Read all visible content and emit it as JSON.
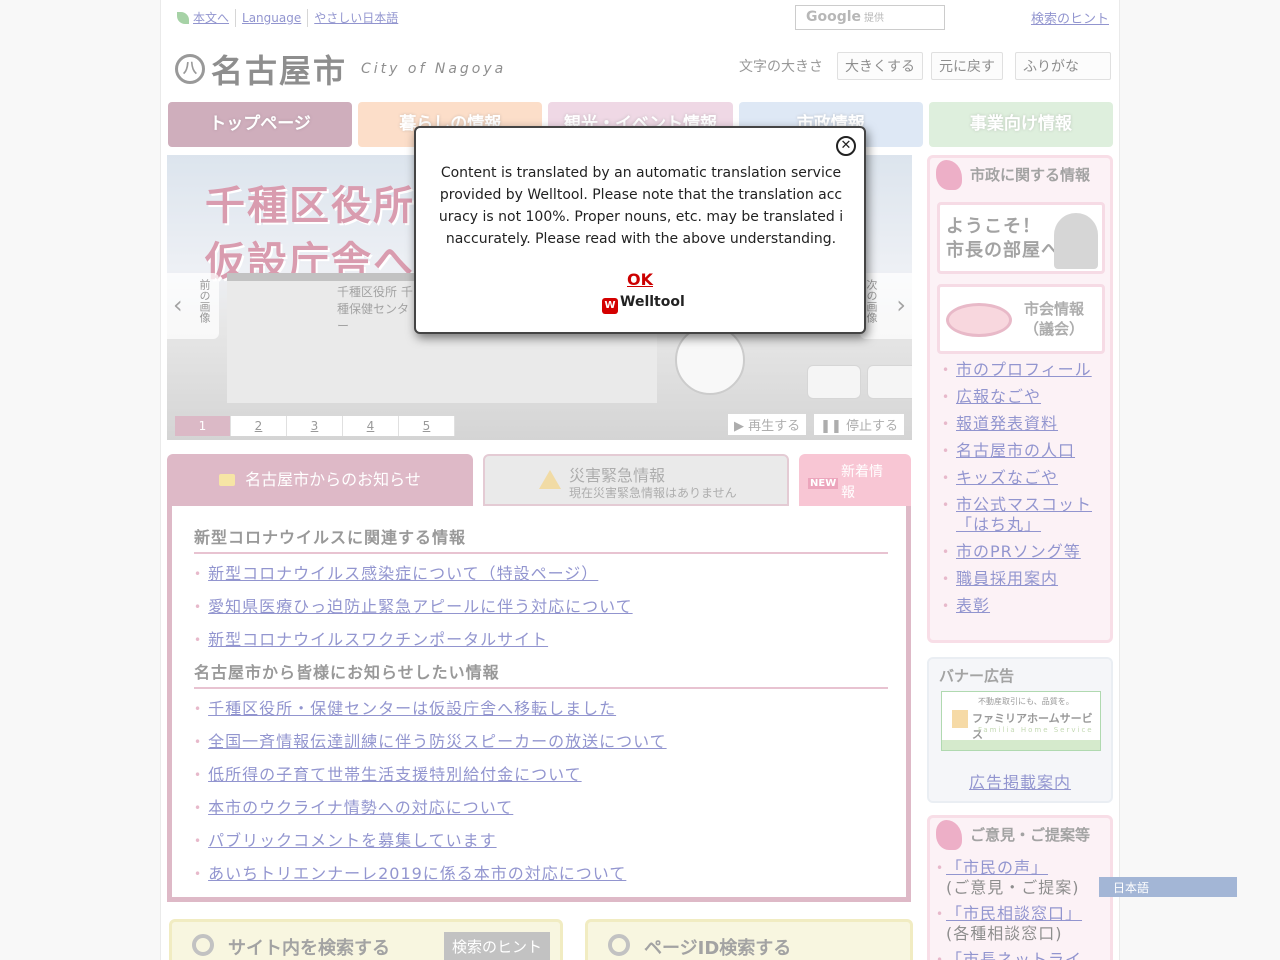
{
  "util": {
    "skip": "本文へ",
    "language": "Language",
    "easy_japanese": "やさしい日本語"
  },
  "google": {
    "brand": "Google",
    "suffix": "提供"
  },
  "search_hint_top": "検索のヒント",
  "logo": {
    "mark": "八",
    "name": "名古屋市",
    "sub": "City of Nagoya"
  },
  "font_size": {
    "label": "文字の大きさ",
    "larger": "大きくする",
    "reset": "元に戻す",
    "furigana": "ふりがな"
  },
  "gnav": [
    "トップページ",
    "暮らしの情報",
    "観光・イベント情報",
    "市政情報",
    "事業向け情報"
  ],
  "slider": {
    "title_line1": "千種区役所・",
    "title_line2": "仮設庁舎へ移転",
    "sign": "千種区役所 千種保健センター",
    "prev": "前の画像",
    "next": "次の画像",
    "pages": [
      "1",
      "2",
      "3",
      "4",
      "5"
    ],
    "play": "▶ 再生する",
    "stop": "❚❚ 停止する"
  },
  "notice_tabs": {
    "news": "名古屋市からのお知らせ",
    "emergency_title": "災害緊急情報",
    "emergency_sub": "現在災害緊急情報はありません",
    "new_badge": "NEW",
    "new_label": "新着情報"
  },
  "notices": {
    "section1_title": "新型コロナウイルスに関連する情報",
    "section1_items": [
      "新型コロナウイルス感染症について（特設ページ）",
      "愛知県医療ひっ迫防止緊急アピールに伴う対応について",
      "新型コロナウイルスワクチンポータルサイト"
    ],
    "section2_title": "名古屋市から皆様にお知らせしたい情報",
    "section2_items": [
      "千種区役所・保健センターは仮設庁舎へ移転しました",
      "全国一斉情報伝達訓練に伴う防災スピーカーの放送について",
      "低所得の子育て世帯生活支援特別給付金について",
      "本市のウクライナ情勢への対応について",
      "パブリックコメントを募集しています",
      "あいちトリエンナーレ2019に係る本市の対応について"
    ]
  },
  "search": {
    "site": "サイト内を検索する",
    "hint": "検索のヒント",
    "page_id": "ページID検索する"
  },
  "city_info": {
    "title": "市政に関する情報",
    "mayor_line1": "ようこそ！",
    "mayor_line2": "市長の部屋へ",
    "council_line1": "市会情報",
    "council_line2": "（議会）",
    "links": [
      "市のプロフィール",
      "広報なごや",
      "報道発表資料",
      "名古屋市の人口",
      "キッズなごや",
      "市公式マスコット「はち丸」",
      "市のPRソング等",
      "職員採用案内",
      "表彰"
    ]
  },
  "banner": {
    "title": "バナー広告",
    "ad_line1": "不動産取引にも、品質を。",
    "ad_line2": "ファミリアホームサービス",
    "ad_line3": "Familia Home Service",
    "link": "広告掲載案内"
  },
  "opinion": {
    "title": "ご意見・ご提案等",
    "items": [
      {
        "link": "「市民の声」",
        "sub": "(ご意見・ご提案)"
      },
      {
        "link": "「市民相談窓口」",
        "sub": "(各種相談窓口)"
      },
      {
        "link": "「市長ネットライ",
        "sub": ""
      }
    ]
  },
  "modal": {
    "text": "Content is translated by an automatic translation service provided by Welltool. Please note that the translation accuracy is not 100%. Proper nouns, etc. may be translated inaccurately. Please read with the above understanding.",
    "ok": "OK",
    "brand": "Welltool",
    "close": "✕"
  },
  "lang_tag": "日本語"
}
